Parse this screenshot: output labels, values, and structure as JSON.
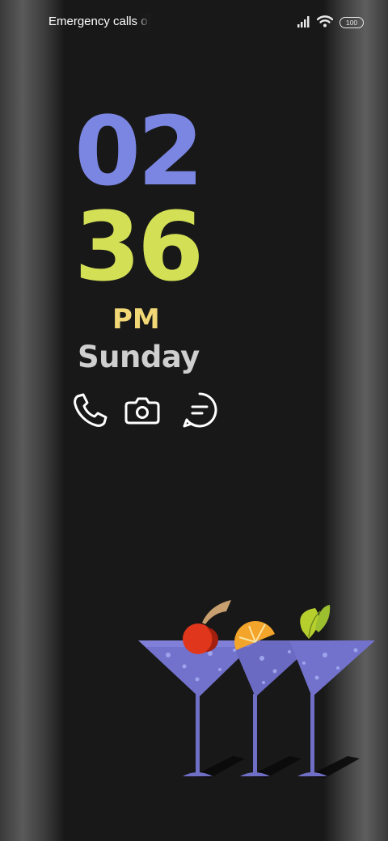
{
  "status_bar": {
    "carrier_text": "Emergency calls only",
    "battery_level": "100",
    "icons": [
      "signal-icon",
      "wifi-icon",
      "battery-icon"
    ]
  },
  "clock": {
    "hour": "02",
    "minute": "36",
    "ampm": "PM",
    "day": "Sunday"
  },
  "shortcuts": [
    {
      "name": "phone-icon"
    },
    {
      "name": "camera-icon"
    },
    {
      "name": "messages-icon"
    }
  ],
  "colors": {
    "hour": "#7b86e2",
    "minute": "#d3df55",
    "ampm": "#f1d776",
    "day": "#cfcfcf",
    "background": "#181818",
    "glass": "#6f6fc6"
  },
  "wallpaper": {
    "motif": "cocktail-glasses",
    "garnishes": [
      "cherry",
      "orange-slice",
      "lime-leaf"
    ]
  }
}
